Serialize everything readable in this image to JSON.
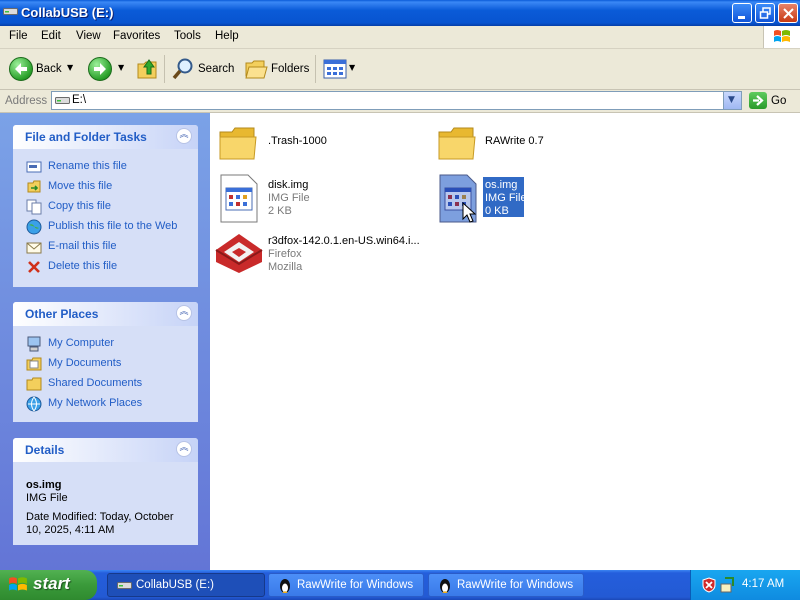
{
  "window": {
    "title": "CollabUSB (E:)"
  },
  "menu": [
    "File",
    "Edit",
    "View",
    "Favorites",
    "Tools",
    "Help"
  ],
  "toolbar": {
    "back": "Back",
    "search": "Search",
    "folders": "Folders"
  },
  "address": {
    "label": "Address",
    "value": "E:\\",
    "go": "Go"
  },
  "left_panel": {
    "tasks": {
      "title": "File and Folder Tasks",
      "items": [
        "Rename this file",
        "Move this file",
        "Copy this file",
        "Publish this file to the Web",
        "E-mail this file",
        "Delete this file"
      ]
    },
    "places": {
      "title": "Other Places",
      "items": [
        "My Computer",
        "My Documents",
        "Shared Documents",
        "My Network Places"
      ]
    },
    "details": {
      "title": "Details",
      "name": "os.img",
      "type": "IMG File",
      "modified": "Date Modified: Today, October 10, 2025, 4:11 AM"
    }
  },
  "files": [
    {
      "name": ".Trash-1000",
      "kind": "folder"
    },
    {
      "name": "RAWrite 0.7",
      "kind": "folder"
    },
    {
      "name": "disk.img",
      "type": "IMG File",
      "size": "2 KB"
    },
    {
      "name": "os.img",
      "type": "IMG File",
      "size": "0 KB",
      "selected": true
    },
    {
      "name": "r3dfox-142.0.1.en-US.win64.i...",
      "type": "Firefox",
      "company": "Mozilla"
    }
  ],
  "taskbar": {
    "start": "start",
    "buttons": [
      "CollabUSB (E:)",
      "RawWrite for Windows",
      "RawWrite for Windows"
    ],
    "clock": "4:17 AM"
  },
  "colors": {
    "title_blue": "#0a5bd8",
    "panel_link": "#215dc6",
    "selection": "#316ac5",
    "start_green": "#3a9a3a"
  }
}
